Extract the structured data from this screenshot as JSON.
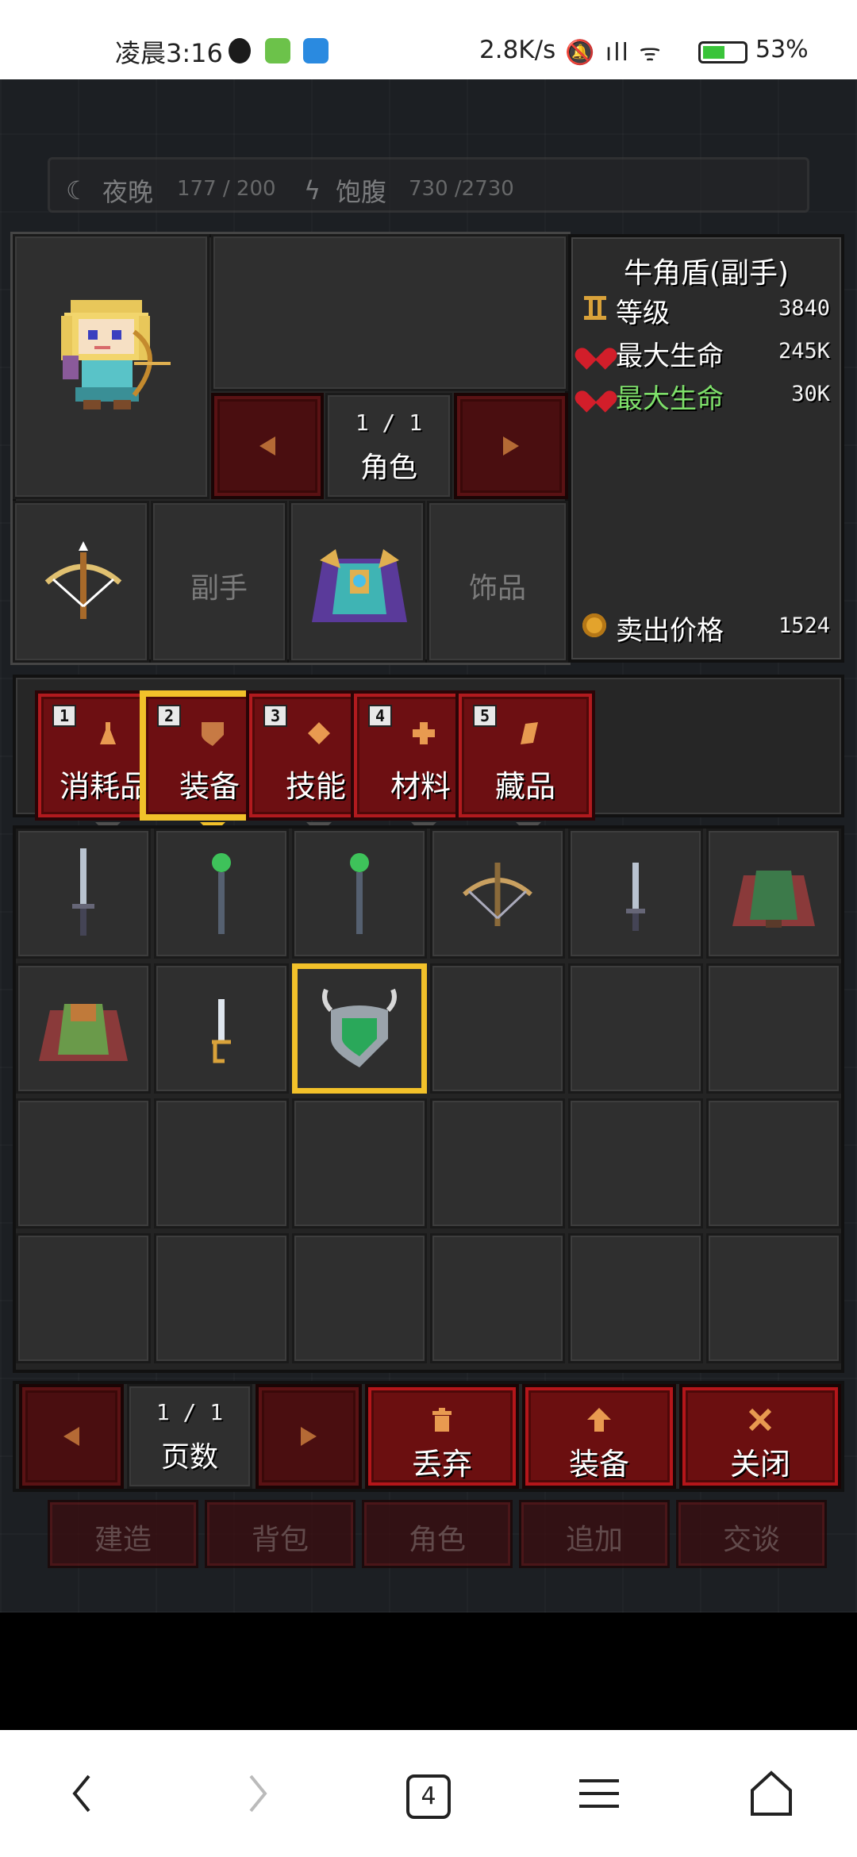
{
  "status_bar": {
    "time": "凌晨3:16",
    "net_speed": "2.8K/s",
    "signal": "HD ıll",
    "battery": "53%",
    "battery_level": 0.53
  },
  "hud": {
    "night_label": "夜晚",
    "night_value": "177 / 200",
    "hunger_label": "饱腹",
    "hunger_value": "730 /2730"
  },
  "character": {
    "page": "1 / 1",
    "label": "角色"
  },
  "equip_slots": [
    {
      "name": "weapon",
      "icon": "crossbow-icon",
      "text": ""
    },
    {
      "name": "offhand",
      "icon": "",
      "text": "副手"
    },
    {
      "name": "armor",
      "icon": "cloak-armor-icon",
      "text": ""
    },
    {
      "name": "accessory",
      "icon": "",
      "text": "饰品"
    }
  ],
  "item_info": {
    "title": "牛角盾(副手)",
    "stats": [
      {
        "icon": "level-icon",
        "label": "等级",
        "value": "3840",
        "color": "#ffffff"
      },
      {
        "icon": "heart-icon",
        "label": "最大生命",
        "value": "245K",
        "color": "#ffffff"
      },
      {
        "icon": "heart-icon",
        "label": "最大生命",
        "value": "30K",
        "color": "#7ee06a"
      }
    ],
    "sell_label": "卖出价格",
    "sell_value": "1524"
  },
  "categories": [
    {
      "num": "1",
      "label": "消耗品",
      "icon": "potion-icon",
      "active": false
    },
    {
      "num": "2",
      "label": "装备",
      "icon": "shield-icon",
      "active": true
    },
    {
      "num": "3",
      "label": "技能",
      "icon": "diamond-icon",
      "active": false
    },
    {
      "num": "4",
      "label": "材料",
      "icon": "cross-icon",
      "active": false
    },
    {
      "num": "5",
      "label": "藏品",
      "icon": "scroll-icon",
      "active": false
    }
  ],
  "inventory": [
    "sword-icon",
    "green-staff-icon",
    "green-staff-icon",
    "crossbow-icon",
    "dagger-icon",
    "green-cloak-icon",
    "brown-cloak-icon",
    "short-sword-icon",
    "horn-shield-icon",
    "",
    "",
    "",
    "",
    "",
    "",
    "",
    "",
    "",
    "",
    "",
    "",
    "",
    "",
    ""
  ],
  "inventory_selected_index": 8,
  "pager": {
    "value": "1 / 1",
    "label": "页数"
  },
  "actions": {
    "discard": "丢弃",
    "equip": "装备",
    "close": "关闭"
  },
  "background_tabs": [
    "建造",
    "背包",
    "角色",
    "追加",
    "交谈"
  ],
  "nav": {
    "tab_count": "4"
  },
  "colors": {
    "accent_red": "#b4161a",
    "selected_gold": "#f2c12a",
    "panel": "#2f2f2f"
  }
}
